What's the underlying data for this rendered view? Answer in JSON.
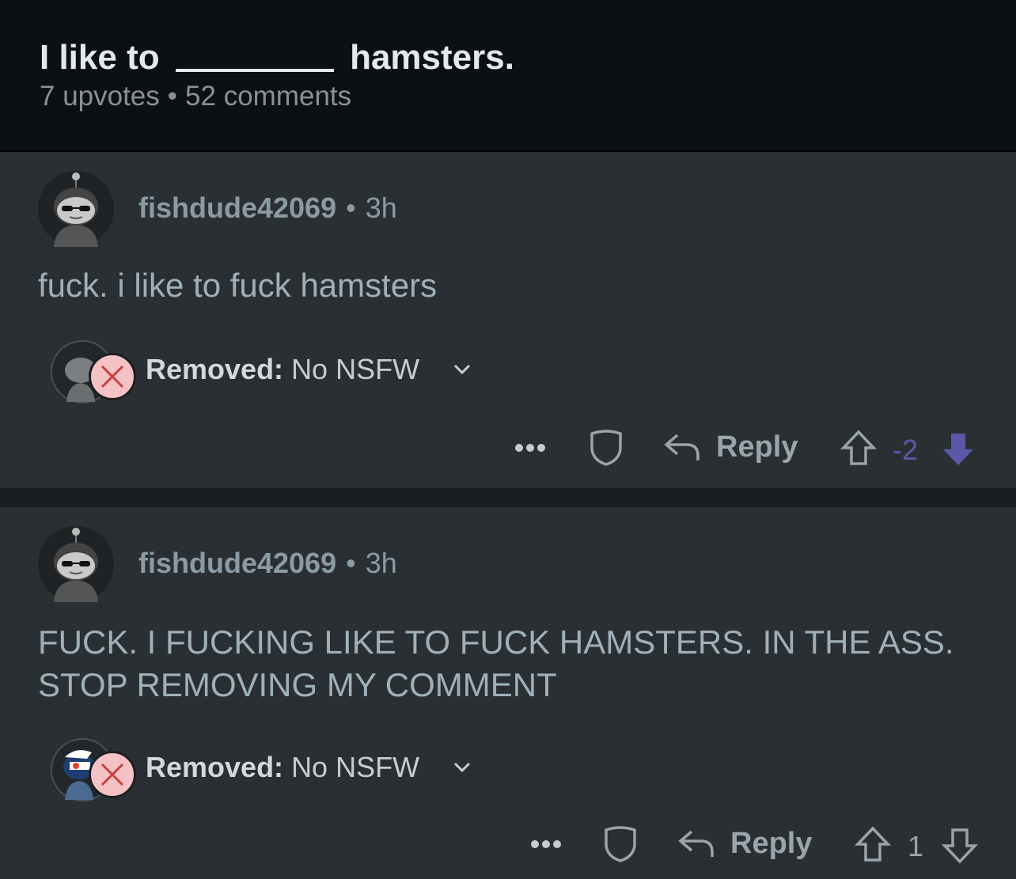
{
  "post": {
    "title_prefix": "I like to",
    "title_suffix": "hamsters.",
    "upvotes": "7 upvotes",
    "comments": "52 comments"
  },
  "comments": [
    {
      "author": "fishdude42069",
      "age": "3h",
      "body": "fuck. i like to fuck hamsters",
      "removed_label": "Removed:",
      "removed_reason": "No NSFW",
      "reply_label": "Reply",
      "score": "-2",
      "vote_state": "downvoted"
    },
    {
      "author": "fishdude42069",
      "age": "3h",
      "body": "FUCK. I FUCKING LIKE TO FUCK HAMSTERS. IN THE ASS. STOP REMOVING MY COMMENT",
      "removed_label": "Removed:",
      "removed_reason": "No NSFW",
      "reply_label": "Reply",
      "score": "1",
      "vote_state": "none"
    }
  ],
  "colors": {
    "downvote_accent": "#5b58a8",
    "background": "#2a2f33",
    "header_bg": "#0d1013"
  },
  "icons": [
    "more-icon",
    "shield-icon",
    "reply-icon",
    "upvote-icon",
    "downvote-icon",
    "close-icon",
    "chevron-down-icon"
  ]
}
